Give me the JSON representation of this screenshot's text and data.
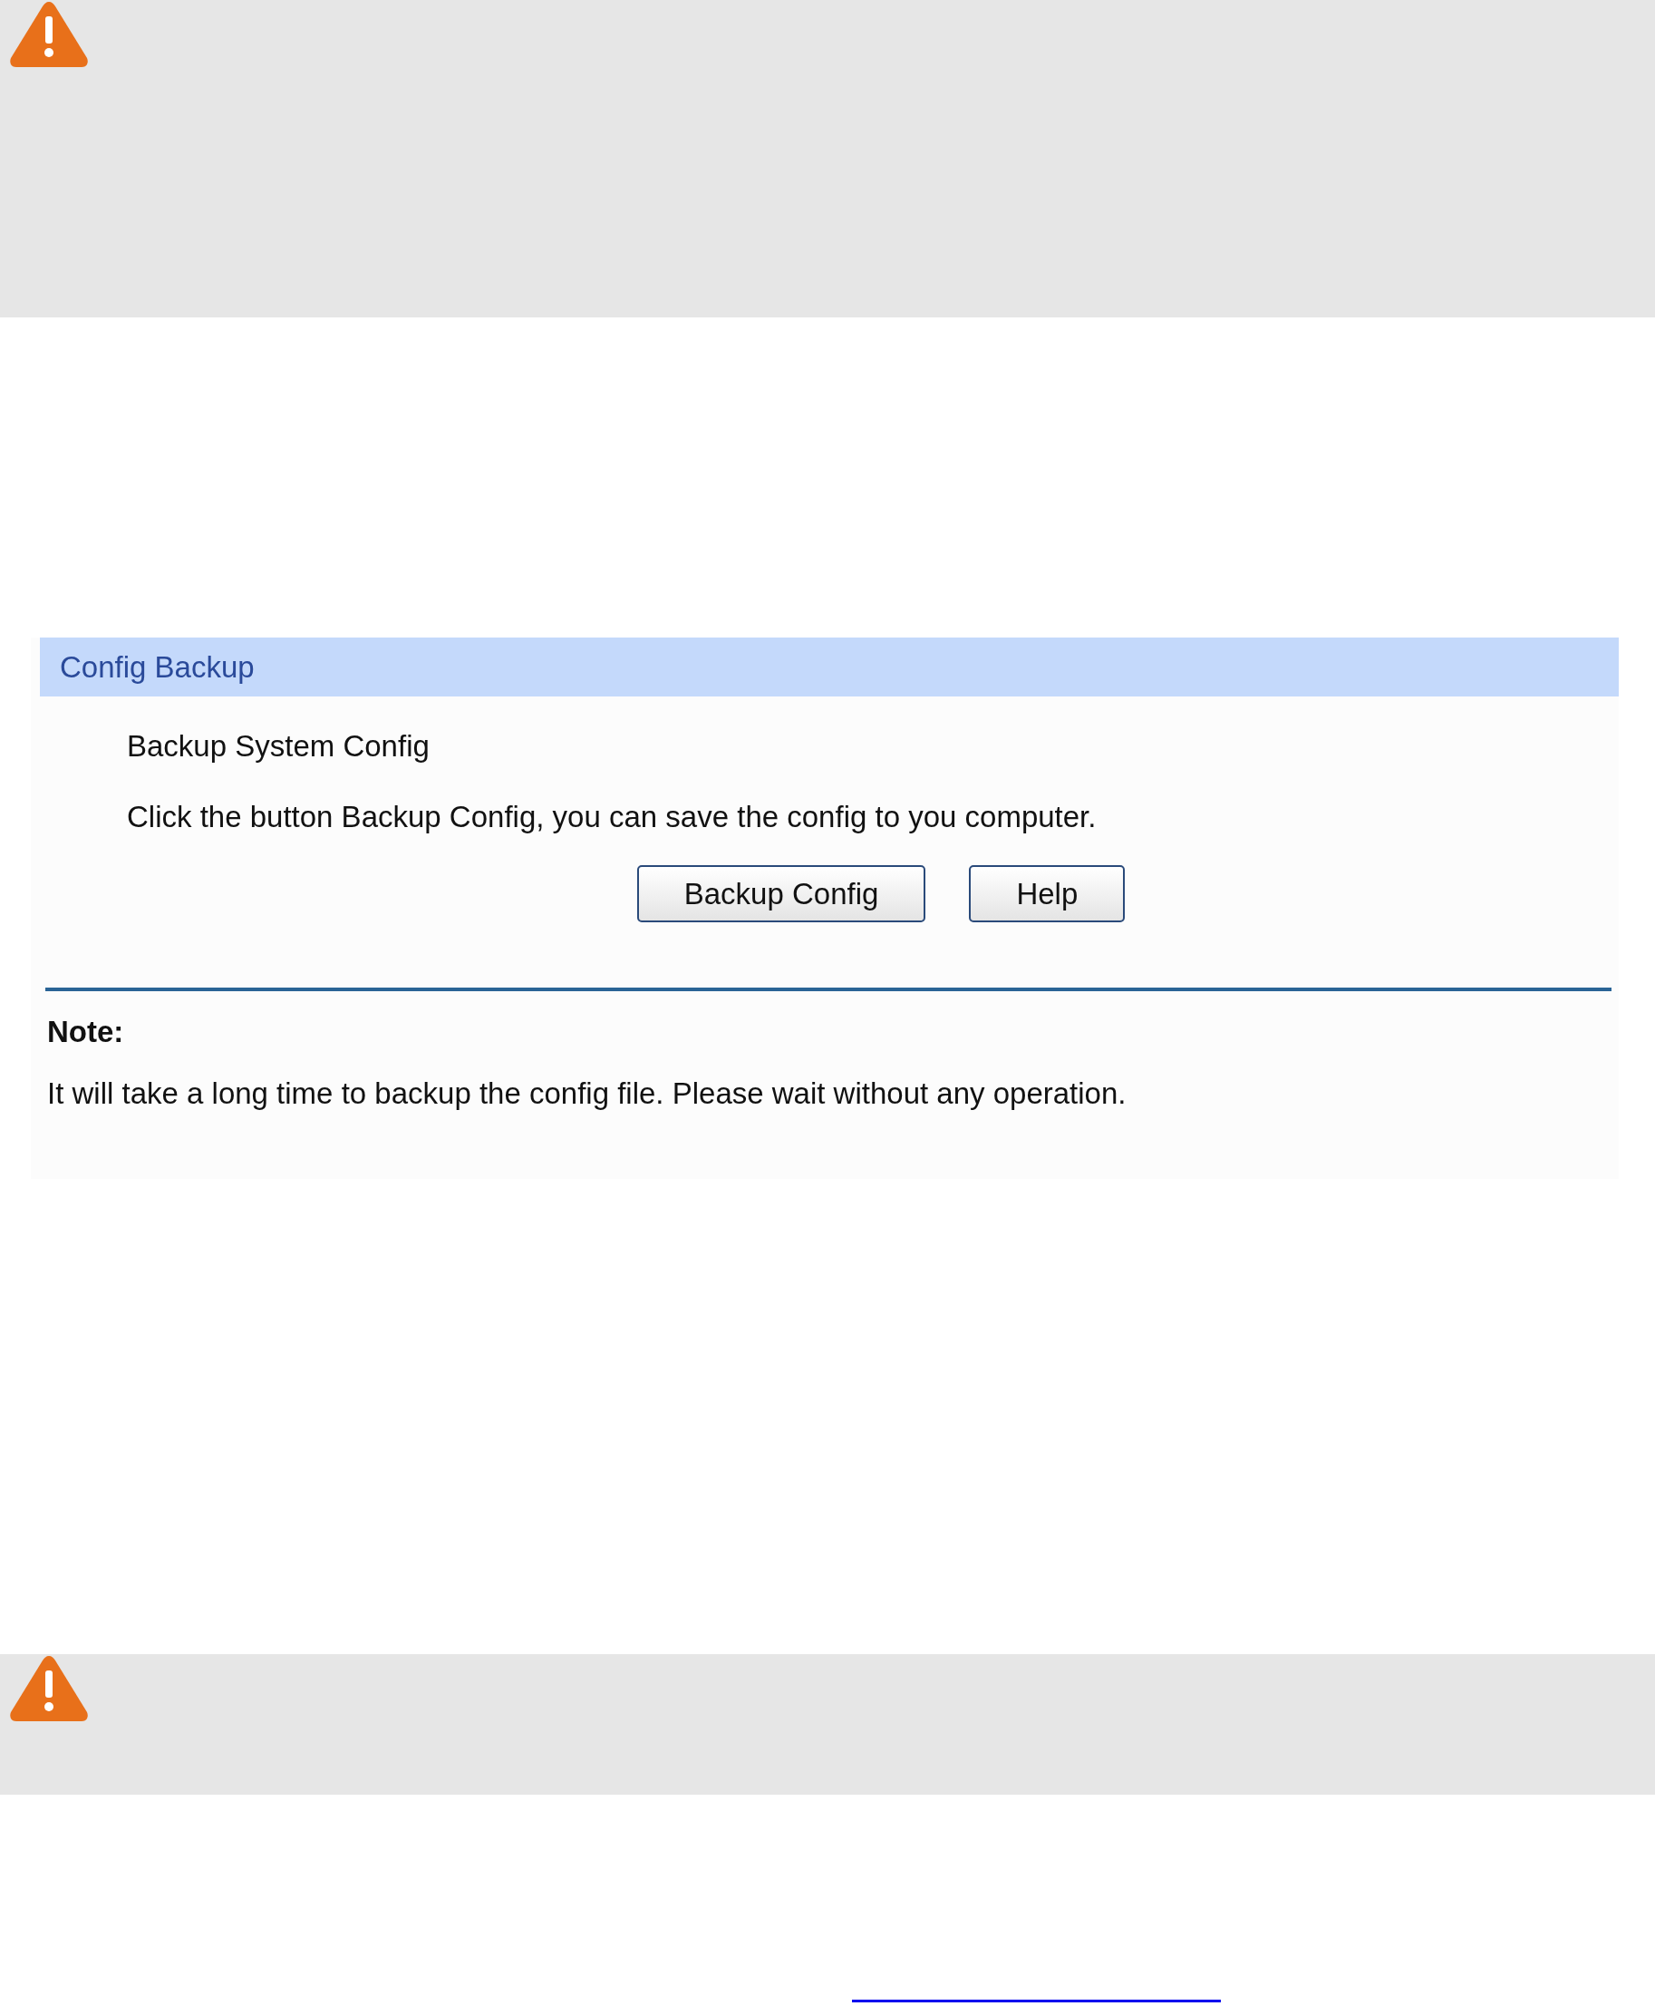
{
  "panel": {
    "title": "Config Backup",
    "heading": "Backup System Config",
    "description": "Click the button Backup Config, you can save the config to you computer.",
    "buttons": [
      "Backup Config",
      "Help"
    ]
  },
  "note": {
    "label": "Note:",
    "text": "It will take a long time to backup the config file. Please wait without any operation."
  }
}
